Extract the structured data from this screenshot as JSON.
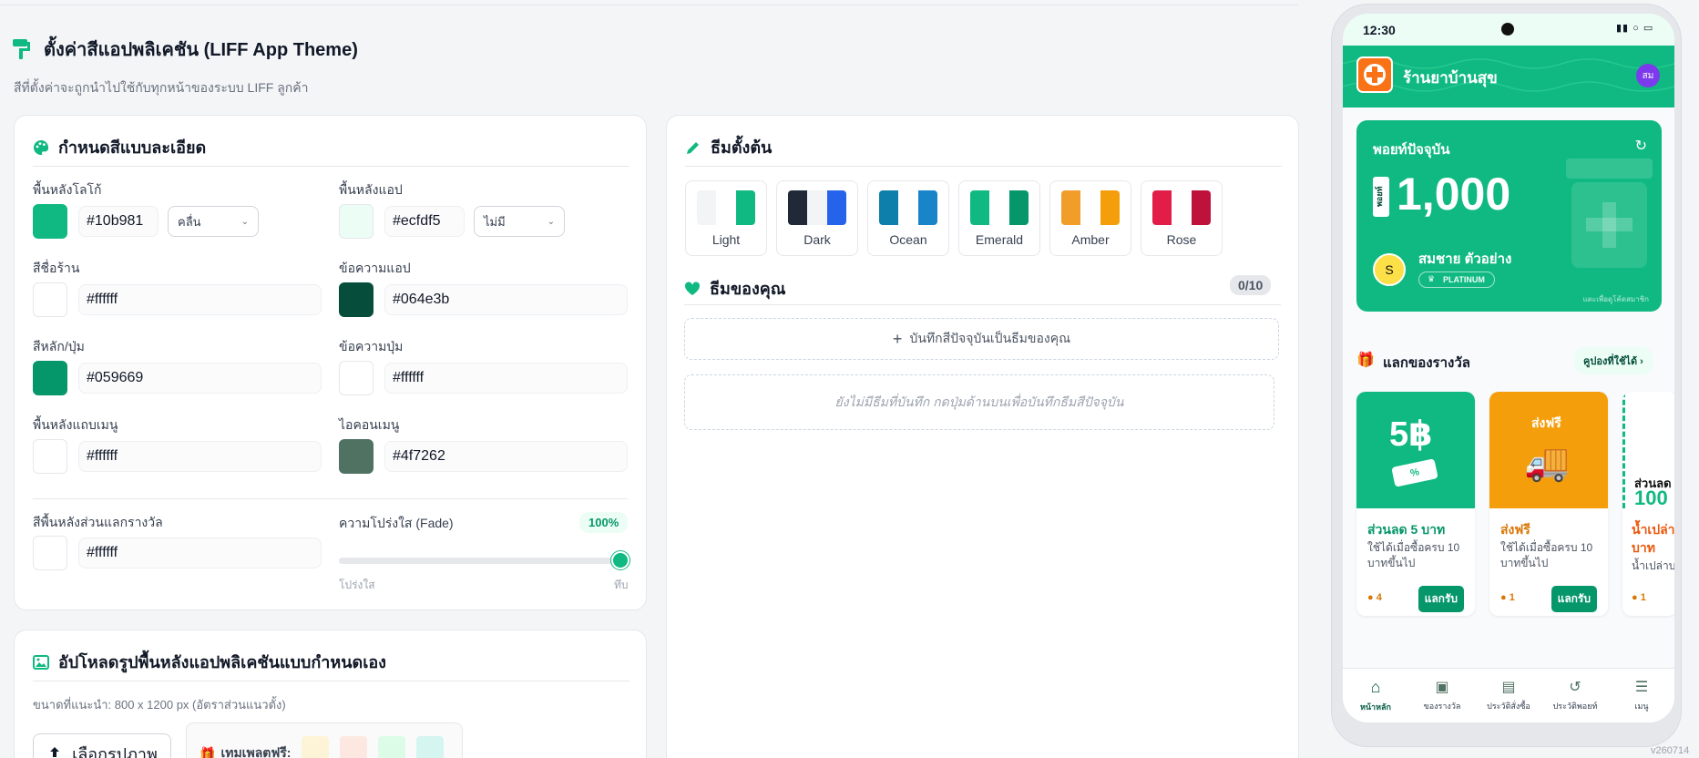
{
  "page": {
    "title": "ตั้งค่าสีแอปพลิเคชัน (LIFF App Theme)",
    "subtitle": "สีที่ตั้งค่าจะถูกนำไปใช้กับทุกหน้าของระบบ LIFF ลูกค้า",
    "version": "v260714"
  },
  "colors": {
    "section_title": "กำหนดสีแบบละเอียด",
    "logo_bg": {
      "label": "พื้นหลังโลโก้",
      "value": "#10b981",
      "mode": "คลื่น"
    },
    "app_bg": {
      "label": "พื้นหลังแอป",
      "value": "#ecfdf5",
      "mode": "ไม่มี"
    },
    "shop_name": {
      "label": "สีชื่อร้าน",
      "value": "#ffffff"
    },
    "app_text": {
      "label": "ข้อความแอป",
      "value": "#064e3b"
    },
    "primary": {
      "label": "สีหลัก/ปุ่ม",
      "value": "#059669"
    },
    "button_text": {
      "label": "ข้อความปุ่ม",
      "value": "#ffffff"
    },
    "menu_bg": {
      "label": "พื้นหลังแถบเมนู",
      "value": "#ffffff"
    },
    "menu_icon": {
      "label": "ไอคอนเมนู",
      "value": "#4f7262"
    },
    "reward_bg": {
      "label": "สีพื้นหลังส่วนแลกรางวัล",
      "value": "#ffffff"
    },
    "fade": {
      "label": "ความโปร่งใส (Fade)",
      "value": "100%",
      "min_label": "โปร่งใส",
      "max_label": "ทึบ",
      "level": 1.0
    }
  },
  "preset": {
    "title": "ธีมตั้งต้น",
    "themes": [
      {
        "name": "Light",
        "c1": "#f3f4f6",
        "c2": "#ffffff",
        "c3": "#10b981"
      },
      {
        "name": "Dark",
        "c1": "#1f2937",
        "c2": "#f3f4f6",
        "c3": "#2563eb"
      },
      {
        "name": "Ocean",
        "c1": "#0e7fab",
        "c2": "#ffffff",
        "c3": "#1a84c9"
      },
      {
        "name": "Emerald",
        "c1": "#10b981",
        "c2": "#ffffff",
        "c3": "#059669"
      },
      {
        "name": "Amber",
        "c1": "#f09d2a",
        "c2": "#ffffff",
        "c3": "#f59e0b"
      },
      {
        "name": "Rose",
        "c1": "#e11d48",
        "c2": "#ffffff",
        "c3": "#be123c"
      }
    ]
  },
  "my_themes": {
    "title": "ธีมของคุณ",
    "count": "0/10",
    "save_label": "บันทึกสีปัจจุบันเป็นธีมของคุณ",
    "empty_text": "ยังไม่มีธีมที่บันทึก กดปุ่มด้านบนเพื่อบันทึกธีมสีปัจจุบัน"
  },
  "upload": {
    "title": "อัปโหลดรูปพื้นหลังแอปพลิเคชันแบบกำหนดเอง",
    "hint": "ขนาดที่แนะนำ: 800 x 1200 px (อัตราส่วนแนวตั้ง)",
    "choose_label": "เลือกรูปภาพ",
    "templates_label": "เทมเพลตฟรี:"
  },
  "phone": {
    "time": "12:30",
    "shop_name": "ร้านยาบ้านสุข",
    "avatar": "สม",
    "points_title": "พอยท์ปัจจุบัน",
    "points_tag": "พอยท์",
    "points_value": "1,000",
    "member_initial": "S",
    "member_name": "สมชาย ตัวอย่าง",
    "tier": "PLATINUM",
    "tap_hint": "แตะเพื่อดูโค้ดสมาชิก",
    "rewards_title": "แลกของรางวัล",
    "coupons_label": "คูปองที่ใช้ได้",
    "rewards": [
      {
        "img_text": "5฿",
        "title": "ส่วนลด 5 บาท",
        "desc": "ใช้ได้เมื่อซื้อครบ 10 บาทขึ้นไป",
        "points": "4",
        "btn": "แลกรับ"
      },
      {
        "img_text": "ส่งฟรี",
        "title": "ส่งฟรี",
        "desc": "ใช้ได้เมื่อซื้อครบ 10 บาทขึ้นไป",
        "points": "1",
        "btn": "แลกรับ"
      },
      {
        "img_text": "ส่วนลด",
        "img_text2": "100",
        "title": "น้ำเปล่า",
        "title2": "บาท",
        "desc": "น้ำเปล่าบ",
        "points": "1"
      }
    ],
    "nav": [
      "หน้าหลัก",
      "ของรางวัล",
      "ประวัติสั่งซื้อ",
      "ประวัติพอยท์",
      "เมนู"
    ]
  }
}
